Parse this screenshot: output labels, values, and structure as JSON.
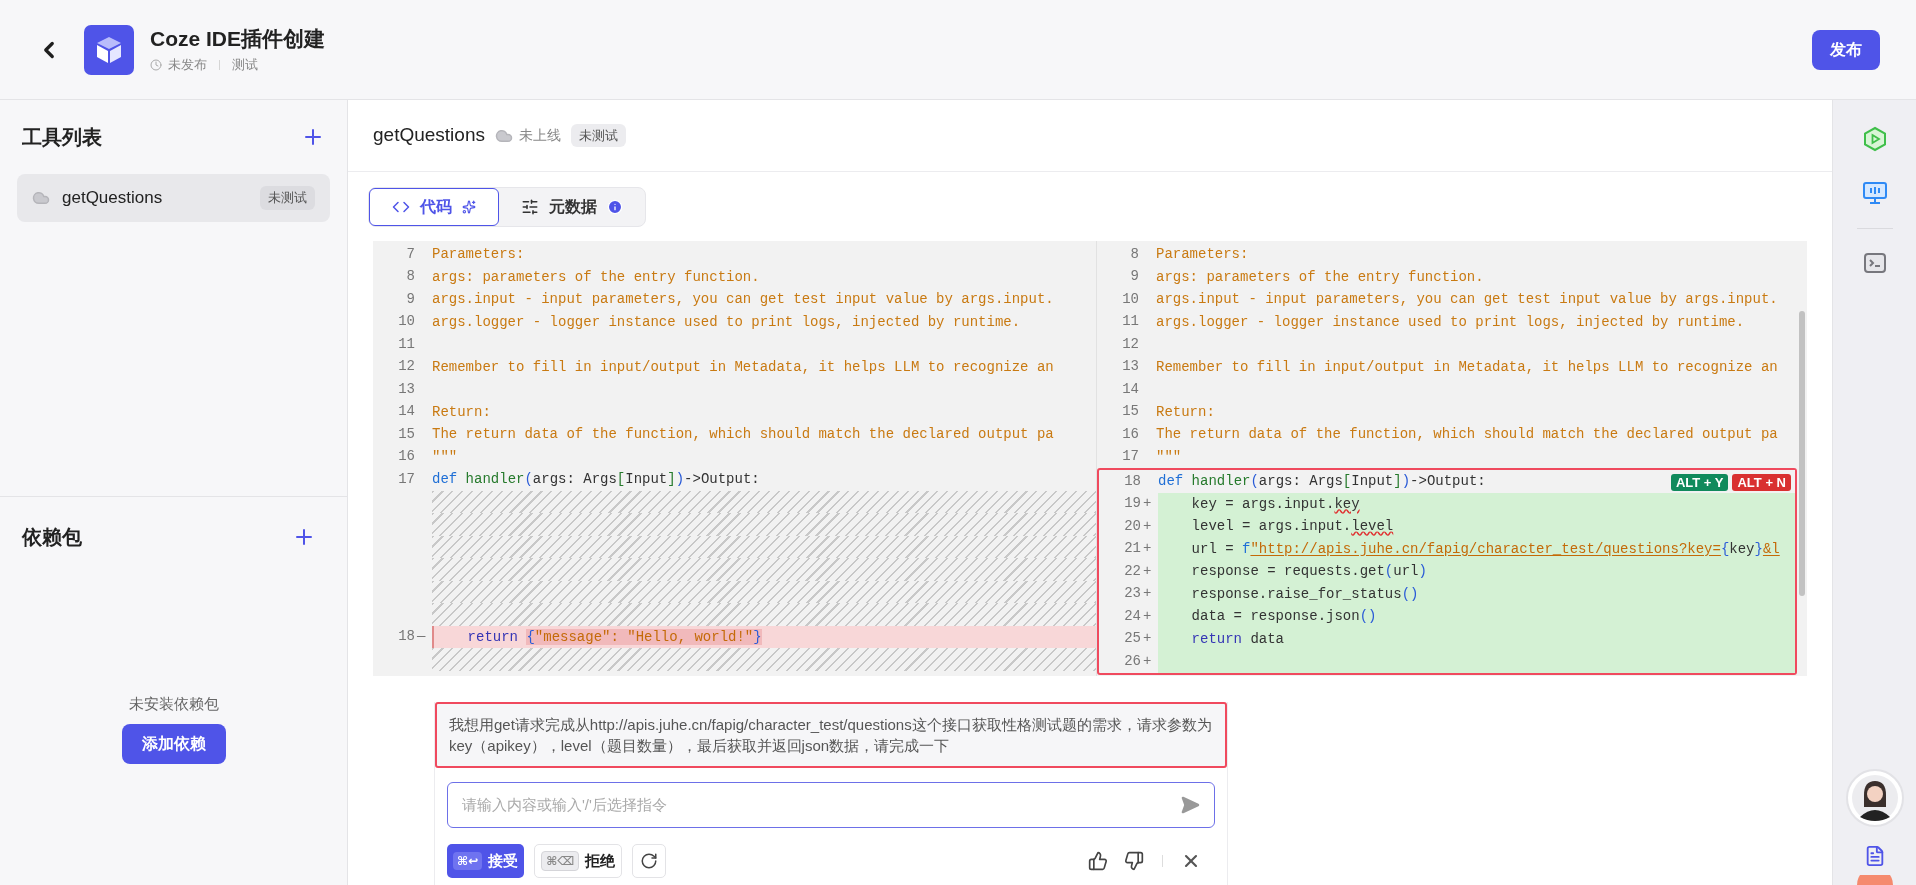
{
  "header": {
    "title": "Coze IDE插件创建",
    "status": "未发布",
    "env": "测试",
    "publish_button": "发布"
  },
  "sidebar": {
    "tools_title": "工具列表",
    "tools": [
      {
        "name": "getQuestions",
        "badge": "未测试",
        "selected": true
      }
    ],
    "deps_title": "依赖包",
    "deps_empty": "未安装依赖包",
    "add_dep_button": "添加依赖"
  },
  "tool": {
    "name": "getQuestions",
    "online_status": "未上线",
    "test_badge": "未测试"
  },
  "tabs": [
    {
      "label": "代码",
      "selected": true,
      "kind": "code"
    },
    {
      "label": "元数据",
      "selected": false,
      "kind": "meta"
    }
  ],
  "diff": {
    "left": [
      {
        "kind": "context",
        "number": "7",
        "segments": [
          {
            "text": "Parameters:",
            "kind": "comment"
          }
        ]
      },
      {
        "kind": "context",
        "number": "8",
        "segments": [
          {
            "text": "args: parameters of the entry function.",
            "kind": "comment"
          }
        ]
      },
      {
        "kind": "context",
        "number": "9",
        "segments": [
          {
            "text": "args.input - input parameters, you can get test input value by args.input.",
            "kind": "comment"
          }
        ]
      },
      {
        "kind": "context",
        "number": "10",
        "segments": [
          {
            "text": "args.logger - logger instance used to print logs, injected by runtime.",
            "kind": "comment"
          }
        ]
      },
      {
        "kind": "context",
        "number": "11"
      },
      {
        "kind": "context",
        "number": "12",
        "segments": [
          {
            "text": "Remember to fill in input/output in Metadata, it helps LLM to recognize an",
            "kind": "comment"
          }
        ]
      },
      {
        "kind": "context",
        "number": "13"
      },
      {
        "kind": "context",
        "number": "14",
        "segments": [
          {
            "text": "Return:",
            "kind": "comment"
          }
        ]
      },
      {
        "kind": "context",
        "number": "15",
        "segments": [
          {
            "text": "The return data of the function, which should match the declared output pa",
            "kind": "comment"
          }
        ]
      },
      {
        "kind": "context",
        "number": "16",
        "segments": [
          {
            "text": "\"\"\"",
            "kind": "comment"
          }
        ]
      },
      {
        "kind": "context",
        "number": "17",
        "segments": [
          {
            "text": "def",
            "kind": "keyword"
          },
          {
            "text": " handler",
            "kind": "func"
          },
          {
            "text": "(",
            "kind": "bracket"
          },
          {
            "text": "args: Args",
            "kind": "plain"
          },
          {
            "text": "[",
            "kind": "func"
          },
          {
            "text": "Input",
            "kind": "plain"
          },
          {
            "text": "]",
            "kind": "func"
          },
          {
            "text": ")",
            "kind": "bracket"
          },
          {
            "text": "->Output:",
            "kind": "plain"
          }
        ]
      },
      {
        "kind": "filler"
      },
      {
        "kind": "filler"
      },
      {
        "kind": "filler"
      },
      {
        "kind": "filler"
      },
      {
        "kind": "filler"
      },
      {
        "kind": "filler"
      },
      {
        "kind": "removed",
        "number": "18",
        "marker": "—",
        "segments": [
          {
            "text": "    return ",
            "kind": "control"
          },
          {
            "text": "{",
            "kind": "bracket_removed"
          },
          {
            "text": "\"message\": \"Hello, world!\"",
            "kind": "string_removed"
          },
          {
            "text": "}",
            "kind": "bracket_removed"
          }
        ]
      },
      {
        "kind": "filler"
      }
    ],
    "right": {
      "before": [
        {
          "kind": "context",
          "number": "8",
          "segments": [
            {
              "text": "Parameters:",
              "kind": "comment"
            }
          ]
        },
        {
          "kind": "context",
          "number": "9",
          "segments": [
            {
              "text": "args: parameters of the entry function.",
              "kind": "comment"
            }
          ]
        },
        {
          "kind": "context",
          "number": "10",
          "segments": [
            {
              "text": "args.input - input parameters, you can get test input value by args.input.",
              "kind": "comment"
            }
          ]
        },
        {
          "kind": "context",
          "number": "11",
          "segments": [
            {
              "text": "args.logger - logger instance used to print logs, injected by runtime.",
              "kind": "comment"
            }
          ]
        },
        {
          "kind": "context",
          "number": "12"
        },
        {
          "kind": "context",
          "number": "13",
          "segments": [
            {
              "text": "Remember to fill in input/output in Metadata, it helps LLM to recognize an",
              "kind": "comment"
            }
          ]
        },
        {
          "kind": "context",
          "number": "14"
        },
        {
          "kind": "context",
          "number": "15",
          "segments": [
            {
              "text": "Return:",
              "kind": "comment"
            }
          ]
        },
        {
          "kind": "context",
          "number": "16",
          "segments": [
            {
              "text": "The return data of the function, which should match the declared output pa",
              "kind": "comment"
            }
          ]
        },
        {
          "kind": "context",
          "number": "17",
          "segments": [
            {
              "text": "\"\"\"",
              "kind": "comment"
            }
          ]
        }
      ],
      "suggestion": [
        {
          "kind": "context",
          "number": "18",
          "segments": [
            {
              "text": "def",
              "kind": "keyword"
            },
            {
              "text": " handler",
              "kind": "func"
            },
            {
              "text": "(",
              "kind": "bracket"
            },
            {
              "text": "args: Args",
              "kind": "plain"
            },
            {
              "text": "[",
              "kind": "func"
            },
            {
              "text": "Input",
              "kind": "plain"
            },
            {
              "text": "]",
              "kind": "func"
            },
            {
              "text": ")",
              "kind": "bracket"
            },
            {
              "text": "->Output:",
              "kind": "plain"
            }
          ]
        },
        {
          "kind": "added",
          "number": "19",
          "marker": "+",
          "segments": [
            {
              "text": "    key = args.input.",
              "kind": "plain"
            },
            {
              "text": "key",
              "kind": "spell"
            }
          ]
        },
        {
          "kind": "added",
          "number": "20",
          "marker": "+",
          "segments": [
            {
              "text": "    level = args.input.",
              "kind": "plain"
            },
            {
              "text": "level",
              "kind": "spell"
            }
          ]
        },
        {
          "kind": "added",
          "number": "21",
          "marker": "+",
          "segments": [
            {
              "text": "    url = ",
              "kind": "plain"
            },
            {
              "text": "f",
              "kind": "keyword"
            },
            {
              "text": "\"http://apis.juhe.cn/fapig/character_test/questions?key=",
              "kind": "link"
            },
            {
              "text": "{",
              "kind": "bracket"
            },
            {
              "text": "key",
              "kind": "plain"
            },
            {
              "text": "}",
              "kind": "bracket"
            },
            {
              "text": "&l",
              "kind": "link"
            }
          ]
        },
        {
          "kind": "added",
          "number": "22",
          "marker": "+",
          "segments": [
            {
              "text": "    response = requests.get",
              "kind": "plain"
            },
            {
              "text": "(",
              "kind": "bracket"
            },
            {
              "text": "url",
              "kind": "plain"
            },
            {
              "text": ")",
              "kind": "bracket"
            }
          ]
        },
        {
          "kind": "added",
          "number": "23",
          "marker": "+",
          "segments": [
            {
              "text": "    response.raise_for_status",
              "kind": "plain"
            },
            {
              "text": "()",
              "kind": "bracket"
            }
          ]
        },
        {
          "kind": "added",
          "number": "24",
          "marker": "+",
          "segments": [
            {
              "text": "    data = response.json",
              "kind": "plain"
            },
            {
              "text": "()",
              "kind": "bracket"
            }
          ]
        },
        {
          "kind": "added",
          "number": "25",
          "marker": "+",
          "segments": [
            {
              "text": "    return",
              "kind": "control"
            },
            {
              "text": " data",
              "kind": "plain"
            }
          ]
        },
        {
          "kind": "added",
          "number": "26",
          "marker": "+"
        }
      ]
    },
    "shortcuts": [
      {
        "label": "ALT + Y",
        "color": "#108a5c"
      },
      {
        "label": "ALT + N",
        "color": "#d93030"
      }
    ]
  },
  "chat": {
    "prompt": "我想用get请求完成从http://apis.juhe.cn/fapig/character_test/questions这个接口获取性格测试题的需求，请求参数为key（apikey），level（题目数量），最后获取并返回json数据，请完成一下",
    "input_placeholder": "请输入内容或输入'/'后选择指令",
    "accept": {
      "keys": "⌘↩",
      "label": "接受"
    },
    "reject": {
      "keys": "⌘⌫",
      "label": "拒绝"
    }
  }
}
